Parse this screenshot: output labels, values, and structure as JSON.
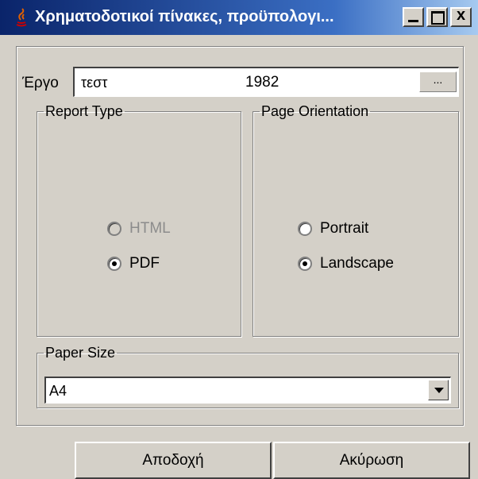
{
  "window": {
    "title": "Χρηματοδοτικοί πίνακες, προϋπολογι...",
    "close_glyph": "x",
    "colors": {
      "titlebar_start": "#0a246a",
      "titlebar_end": "#a6caf0",
      "face": "#d4d0c8"
    }
  },
  "project": {
    "label": "Έργο",
    "name": "τεστ",
    "year": "1982",
    "browse_label": "..."
  },
  "report_type": {
    "legend": "Report Type",
    "options": [
      {
        "label": "HTML",
        "checked": false,
        "enabled": false
      },
      {
        "label": "PDF",
        "checked": true,
        "enabled": true
      }
    ]
  },
  "page_orientation": {
    "legend": "Page Orientation",
    "options": [
      {
        "label": "Portrait",
        "checked": false,
        "enabled": true
      },
      {
        "label": "Landscape",
        "checked": true,
        "enabled": true
      }
    ]
  },
  "paper_size": {
    "legend": "Paper Size",
    "value": "A4"
  },
  "buttons": {
    "ok_label": "Αποδοχή",
    "cancel_label": "Ακύρωση"
  }
}
